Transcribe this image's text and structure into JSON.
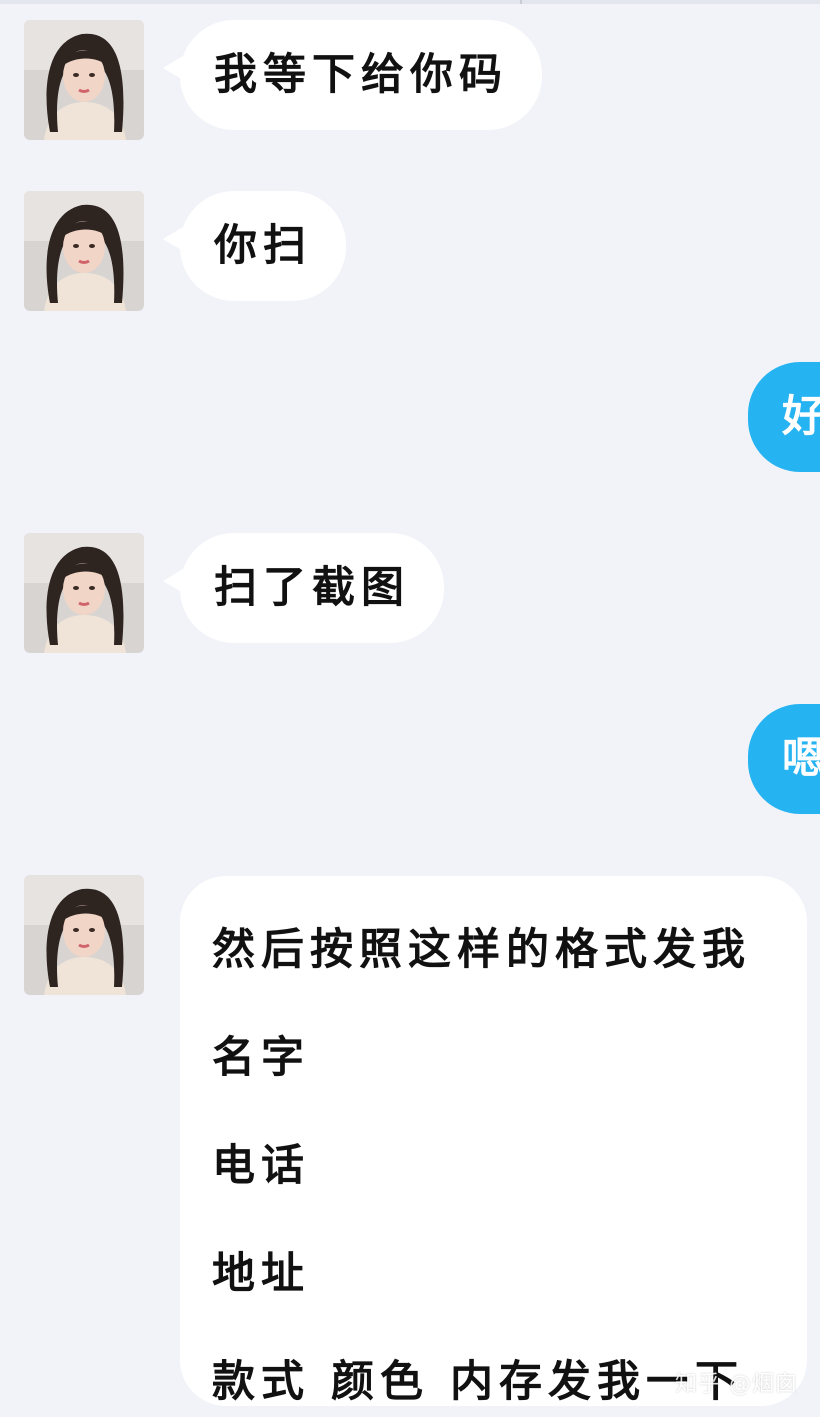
{
  "messages": [
    {
      "side": "left",
      "text": "我等下给你码"
    },
    {
      "side": "left",
      "text": "你扫"
    },
    {
      "side": "right",
      "text": "好"
    },
    {
      "side": "left",
      "text": "扫了截图"
    },
    {
      "side": "right",
      "text": "嗯"
    },
    {
      "side": "left",
      "lines": [
        "然后按照这样的格式发我",
        "名字",
        "电话",
        "地址",
        "款式 颜色 内存发我一下"
      ]
    }
  ],
  "watermark": "知乎 @烟囱",
  "colors": {
    "background": "#f2f3f8",
    "incoming_bubble": "#ffffff",
    "outgoing_bubble": "#26b3f2"
  },
  "avatar_icon": "woman-portrait-avatar"
}
